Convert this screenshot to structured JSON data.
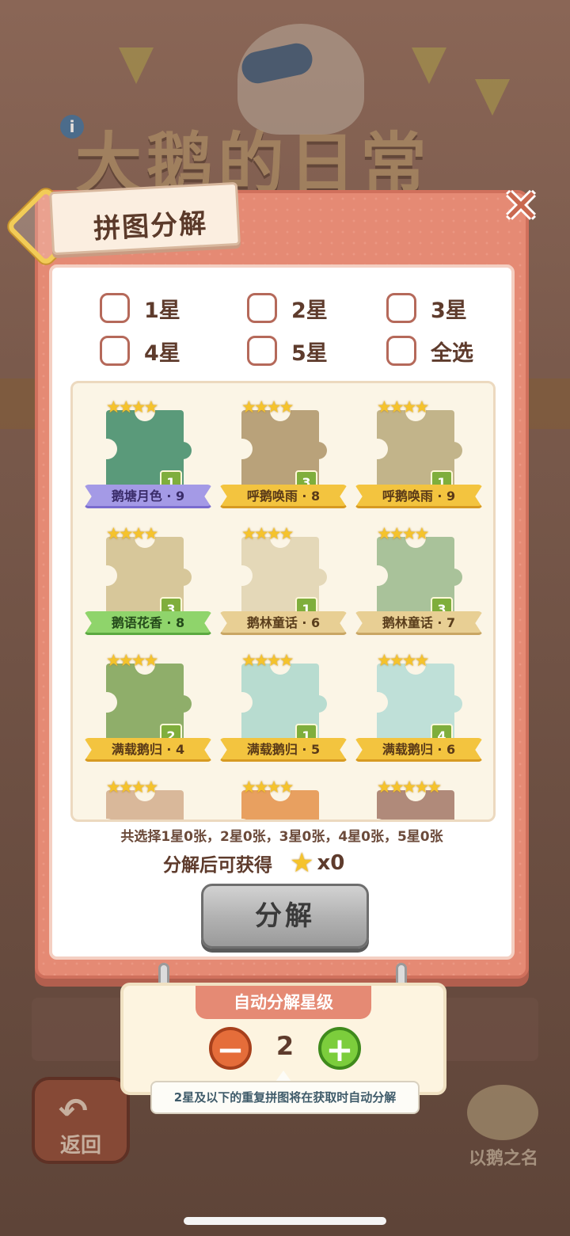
{
  "background": {
    "game_title": "大鹅的日常",
    "back_label": "返回",
    "brand": "以鹅之名"
  },
  "dialog": {
    "title": "拼图分解",
    "close_icon": "close-icon",
    "filters": [
      {
        "label": "1星",
        "checked": false
      },
      {
        "label": "2星",
        "checked": false
      },
      {
        "label": "3星",
        "checked": false
      },
      {
        "label": "4星",
        "checked": false
      },
      {
        "label": "5星",
        "checked": false
      },
      {
        "label": "全选",
        "checked": false
      }
    ],
    "cards": [
      {
        "stars": "★★★★",
        "count": "1",
        "name": "鹅塘月色 · 9",
        "ribbon": "purple",
        "color": "#5a9a7a"
      },
      {
        "stars": "★★★★",
        "count": "3",
        "name": "呼鹅唤雨 · 8",
        "ribbon": "gold",
        "color": "#b9a27a"
      },
      {
        "stars": "★★★★",
        "count": "1",
        "name": "呼鹅唤雨 · 9",
        "ribbon": "gold",
        "color": "#c2b48a"
      },
      {
        "stars": "★★★★",
        "count": "3",
        "name": "鹅语花香 · 8",
        "ribbon": "green",
        "color": "#d7c79a"
      },
      {
        "stars": "★★★★",
        "count": "1",
        "name": "鹅林童话 · 6",
        "ribbon": "tan",
        "color": "#e4d8b8"
      },
      {
        "stars": "★★★★",
        "count": "3",
        "name": "鹅林童话 · 7",
        "ribbon": "tan",
        "color": "#a9c29a"
      },
      {
        "stars": "★★★★",
        "count": "2",
        "name": "满载鹅归 · 4",
        "ribbon": "gold",
        "color": "#8fae6a"
      },
      {
        "stars": "★★★★",
        "count": "1",
        "name": "满载鹅归 · 5",
        "ribbon": "gold",
        "color": "#b8dcd0"
      },
      {
        "stars": "★★★★",
        "count": "4",
        "name": "满载鹅归 · 6",
        "ribbon": "gold",
        "color": "#bfe0d8"
      },
      {
        "stars": "★★★★",
        "count": "",
        "name": "",
        "ribbon": "gold",
        "color": "#d9b89a"
      },
      {
        "stars": "★★★★",
        "count": "",
        "name": "",
        "ribbon": "gold",
        "color": "#e8a060"
      },
      {
        "stars": "★★★★★",
        "count": "",
        "name": "",
        "ribbon": "gold",
        "color": "#b08a7a"
      }
    ],
    "summary": "共选择1星0张，2星0张，3星0张，4星0张，5星0张",
    "gain_label": "分解后可获得",
    "gain_count": "x0",
    "decompose_button": "分解"
  },
  "auto_decompose": {
    "title": "自动分解星级",
    "level": "2",
    "minus_icon": "minus-icon",
    "plus_icon": "plus-icon",
    "tip": "2星及以下的重复拼图将在获取时自动分解"
  }
}
